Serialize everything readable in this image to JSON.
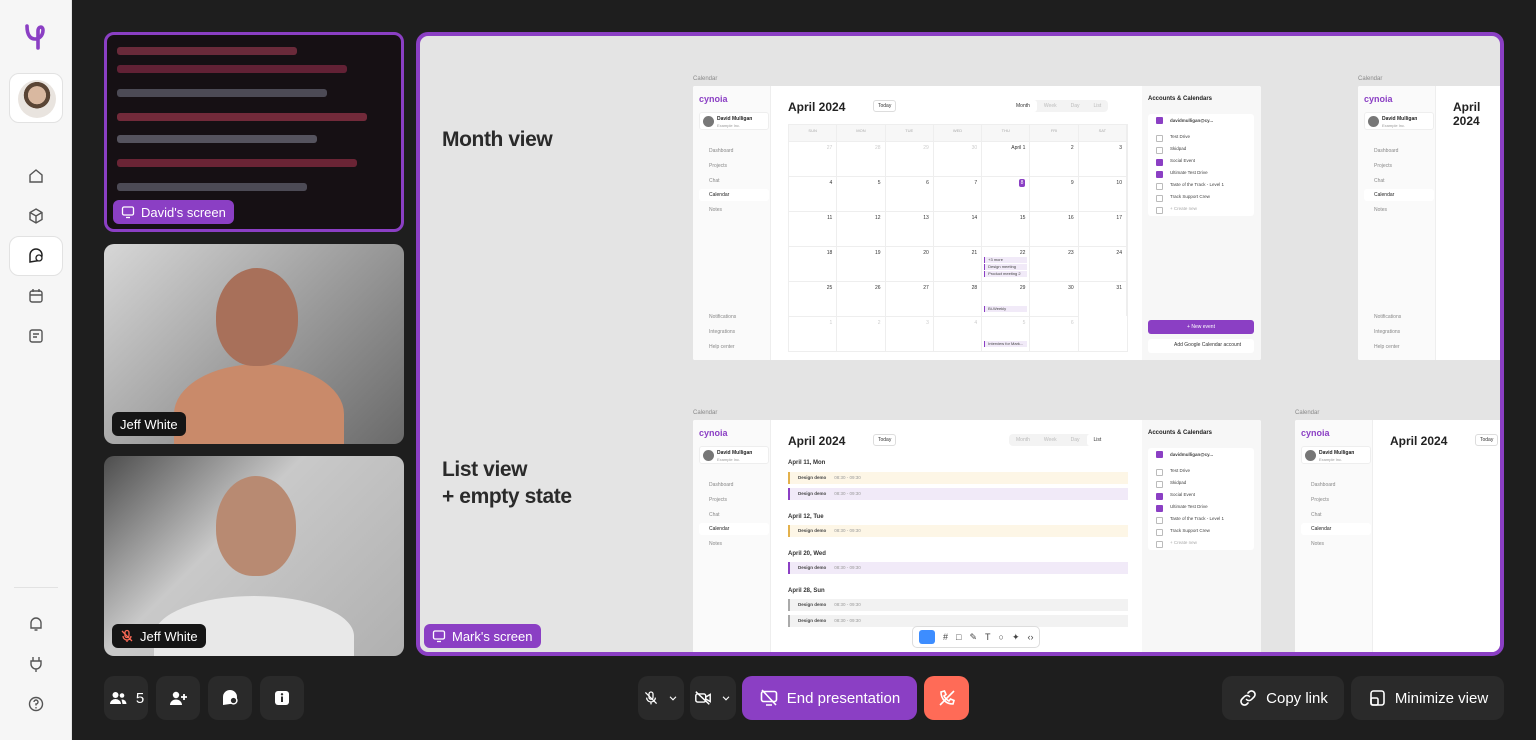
{
  "participants": [
    {
      "label": "David's screen",
      "type": "screen"
    },
    {
      "label": "Jeff White",
      "type": "camera",
      "muted": false
    },
    {
      "label": "Jeff White",
      "type": "camera",
      "muted": true
    }
  ],
  "presentation": {
    "label": "Mark's screen",
    "sections": [
      {
        "title": "Month view"
      },
      {
        "title": "List view\n+ empty state"
      }
    ],
    "mock": {
      "caption": "Calendar",
      "logo": "cynoia",
      "user_name": "David Mulligan",
      "user_sub": "Example Inc.",
      "nav": [
        "Dashboard",
        "Projects",
        "Chat",
        "Calendar",
        "Notes"
      ],
      "nav_bottom": [
        "Notifications",
        "Integrations",
        "Help center"
      ],
      "month_title": "April 2024",
      "today": "Today",
      "views": [
        "Month",
        "Week",
        "Day",
        "List"
      ],
      "weekdays": [
        "SUN",
        "MON",
        "TUE",
        "WED",
        "THU",
        "FRI",
        "SAT"
      ],
      "accounts_title": "Accounts & Calendars",
      "account_email": "davidmulligan@cy...",
      "calendars": [
        "Test Drive",
        "Skidpad",
        "Social Event",
        "Ultimate Test Drive",
        "Taste of the Track - Level 1",
        "Track Support Crew"
      ],
      "create_new": "+ Create new",
      "new_event": "+ New event",
      "add_google": "Add Google Calendar account",
      "events": {
        "more": "+3 more",
        "design": "Design meeting",
        "product": "Product meeting 2",
        "weekly": "Bi-Weekly",
        "interview": "Interview for Mark..."
      },
      "list_days": [
        {
          "day": "April 11, Mon",
          "items": [
            {
              "name": "Design demo",
              "time": "08:30 - 09:30"
            },
            {
              "name": "Design demo",
              "time": "08:30 - 09:30"
            }
          ]
        },
        {
          "day": "April 12, Tue",
          "items": [
            {
              "name": "Design demo",
              "time": "08:30 - 09:30"
            }
          ]
        },
        {
          "day": "April 20, Wed",
          "items": [
            {
              "name": "Design demo",
              "time": "08:30 - 09:30"
            }
          ]
        },
        {
          "day": "April 28, Sun",
          "items": [
            {
              "name": "Design demo",
              "time": "08:30 - 09:30"
            },
            {
              "name": "Design demo",
              "time": "08:30 - 09:30"
            }
          ]
        }
      ],
      "month_cells": [
        "27",
        "28",
        "29",
        "30",
        "April 1",
        "2",
        "3",
        "4",
        "5",
        "6",
        "7",
        "8",
        "9",
        "10",
        "11",
        "12",
        "13",
        "14",
        "15",
        "16",
        "17",
        "18",
        "19",
        "20",
        "21",
        "22",
        "23",
        "24",
        "25",
        "26",
        "27",
        "28",
        "29",
        "30",
        "31",
        "1",
        "2",
        "3",
        "4",
        "5",
        "6"
      ]
    }
  },
  "controls": {
    "participants_count": "5",
    "end_presentation": "End presentation",
    "copy_link": "Copy link",
    "minimize_view": "Minimize view"
  },
  "colors": {
    "accent": "#8b3fc4",
    "danger": "#ff6b57",
    "background": "#1e1e1e"
  },
  "icons": [
    "logo-icon",
    "home-icon",
    "cube-icon",
    "chat-icon",
    "calendar-icon",
    "notes-icon",
    "bell-icon",
    "plug-icon",
    "help-icon",
    "users-icon",
    "add-user-icon",
    "info-icon",
    "mic-off-icon",
    "video-off-icon",
    "screen-share-off-icon",
    "hang-up-icon",
    "link-icon",
    "minimize-icon"
  ]
}
